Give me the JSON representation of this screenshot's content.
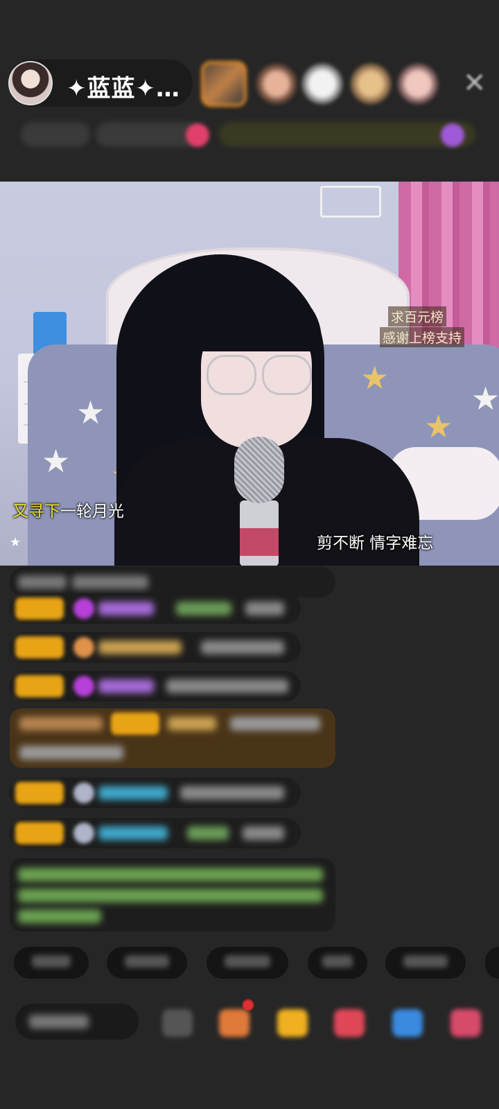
{
  "header": {
    "host_name": "✦蓝蓝✦…",
    "close_icon": "close-icon"
  },
  "video": {
    "lyric_line_1_highlight": "又寻下",
    "lyric_line_1_rest": "一轮月光",
    "lyric_line_2": "剪不断 情字难忘",
    "notice_1": "求百元榜",
    "notice_2": "感谢上榜支持"
  }
}
